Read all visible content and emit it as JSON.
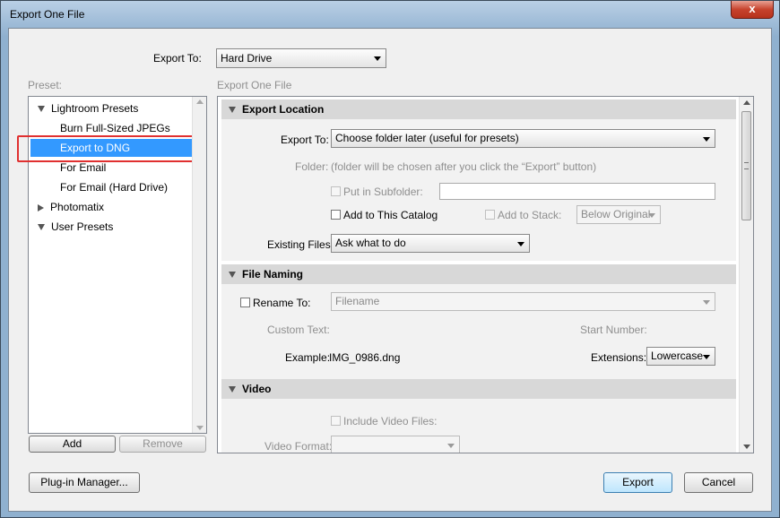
{
  "window": {
    "title": "Export One File",
    "close_glyph": "x"
  },
  "export_to": {
    "label": "Export To:",
    "value": "Hard Drive"
  },
  "preset": {
    "label": "Preset:",
    "items": [
      {
        "label": "Lightroom Presets"
      },
      {
        "label": "Burn Full-Sized JPEGs"
      },
      {
        "label": "Export to DNG"
      },
      {
        "label": "For Email"
      },
      {
        "label": "For Email (Hard Drive)"
      },
      {
        "label": "Photomatix"
      },
      {
        "label": "User Presets"
      }
    ],
    "add_label": "Add",
    "remove_label": "Remove"
  },
  "settings_title": "Export One File",
  "export_location": {
    "header": "Export Location",
    "export_to_label": "Export To:",
    "export_to_value": "Choose folder later (useful for presets)",
    "folder_label": "Folder:",
    "folder_note": "(folder will be chosen after you click the “Export” button)",
    "subfolder_label": "Put in Subfolder:",
    "add_catalog_label": "Add to This Catalog",
    "add_stack_label": "Add to Stack:",
    "stack_value": "Below Original",
    "existing_files_label": "Existing Files:",
    "existing_files_value": "Ask what to do"
  },
  "file_naming": {
    "header": "File Naming",
    "rename_label": "Rename To:",
    "rename_value": "Filename",
    "custom_text_label": "Custom Text:",
    "start_number_label": "Start Number:",
    "example_label": "Example:",
    "example_value": "IMG_0986.dng",
    "extensions_label": "Extensions:",
    "extensions_value": "Lowercase"
  },
  "video": {
    "header": "Video",
    "include_label": "Include Video Files:",
    "format_label": "Video Format:"
  },
  "footer": {
    "plugin_manager_label": "Plug-in Manager...",
    "export_label": "Export",
    "cancel_label": "Cancel"
  }
}
